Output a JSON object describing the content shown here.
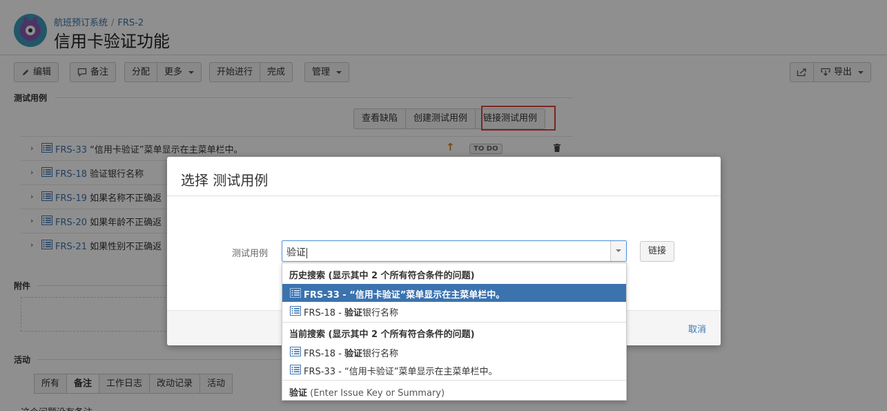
{
  "header": {
    "project": "航班预订系统",
    "issue_key": "FRS-2",
    "separator": "/",
    "title": "信用卡验证功能"
  },
  "toolbar": {
    "edit": "编辑",
    "comment": "备注",
    "assign": "分配",
    "more": "更多",
    "start_progress": "开始进行",
    "done": "完成",
    "admin": "管理",
    "export": "导出"
  },
  "test_cases": {
    "section_label": "测试用例",
    "actions": [
      "查看缺陷",
      "创建测试用例",
      "链接测试用例"
    ],
    "rows": [
      {
        "key": "FRS-33",
        "summary": "“信用卡验证”菜单显示在主菜单栏中。",
        "status": "TO DO"
      },
      {
        "key": "FRS-18",
        "summary": "验证银行名称"
      },
      {
        "key": "FRS-19",
        "summary": "如果名称不正确返"
      },
      {
        "key": "FRS-20",
        "summary": "如果年龄不正确返"
      },
      {
        "key": "FRS-21",
        "summary": "如果性别不正确返"
      }
    ]
  },
  "attachments": {
    "label": "附件"
  },
  "activity": {
    "label": "活动",
    "tabs": [
      "所有",
      "备注",
      "工作日志",
      "改动记录",
      "活动"
    ],
    "active_tab": "备注",
    "empty_text": "这个问题没有备注"
  },
  "dialog": {
    "title": "选择 测试用例",
    "field_label": "测试用例",
    "input_value": "验证",
    "link_button": "链接",
    "cancel": "取消"
  },
  "dropdown": {
    "history_header": "历史搜索 (显示其中 2 个所有符合条件的问题)",
    "history_items": [
      {
        "key": "FRS-33",
        "dash": " - ",
        "pre": "",
        "match": "",
        "post": "“信用卡验证”菜单显示在主菜单栏中。"
      },
      {
        "key": "FRS-18",
        "dash": " - ",
        "pre": "",
        "match": "验证",
        "post": "银行名称"
      }
    ],
    "current_header": "当前搜索 (显示其中 2 个所有符合条件的问题)",
    "current_items": [
      {
        "key": "FRS-18",
        "dash": " - ",
        "pre": "",
        "match": "验证",
        "post": "银行名称"
      },
      {
        "key": "FRS-33",
        "dash": " - ",
        "pre": "",
        "match": "",
        "post": "“信用卡验证”菜单显示在主菜单栏中。"
      }
    ],
    "hint_query": "验证",
    "hint_text": " (Enter Issue Key or Summary)"
  },
  "colors": {
    "link": "#3b73af",
    "selected": "#3b73af",
    "highlight_border": "#e0433a",
    "priority_arrow": "#e07a17"
  }
}
